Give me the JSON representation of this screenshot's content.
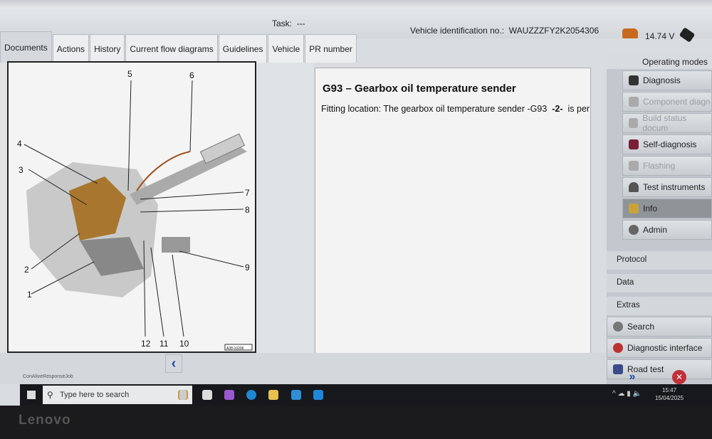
{
  "header": {
    "task_label": "Task:",
    "task_value": "---",
    "vin_label": "Vehicle identification no.:",
    "vin_value": "WAUZZZFY2K2054306",
    "voltage": "14.74 V"
  },
  "tabs": [
    {
      "label": "Documents",
      "active": true
    },
    {
      "label": "Actions"
    },
    {
      "label": "History"
    },
    {
      "label": "Current flow diagrams"
    },
    {
      "label": "Guidelines"
    },
    {
      "label": "Vehicle"
    },
    {
      "label": "PR number"
    }
  ],
  "diagram": {
    "callouts": [
      "1",
      "2",
      "3",
      "4",
      "5",
      "6",
      "7",
      "8",
      "9",
      "10",
      "11",
      "12"
    ],
    "ref_code": "A38-10206"
  },
  "content": {
    "title": "G93 – Gearbox oil temperature sender",
    "text_prefix": "Fitting location: The gearbox oil temperature sender -G93",
    "text_bold": "-2-",
    "text_suffix": "is permaner"
  },
  "sidebar": {
    "heading": "Operating modes",
    "modes": [
      {
        "label": "Diagnosis",
        "icon": "diagnosis-icon"
      },
      {
        "label": "Component diagn",
        "icon": "component-icon",
        "disabled": true
      },
      {
        "label": "Build status docum",
        "icon": "build-status-icon",
        "disabled": true
      },
      {
        "label": "Self-diagnosis",
        "icon": "self-diagnosis-icon"
      },
      {
        "label": "Flashing",
        "icon": "flashing-icon",
        "disabled": true
      },
      {
        "label": "Test instruments",
        "icon": "gauge-icon"
      },
      {
        "label": "Info",
        "icon": "info-icon",
        "selected": true
      },
      {
        "label": "Admin",
        "icon": "gear-icon"
      }
    ],
    "sections": [
      "Protocol",
      "Data",
      "Extras"
    ],
    "extras": [
      {
        "label": "Search",
        "icon": "magnifier-icon"
      },
      {
        "label": "Diagnostic interface",
        "icon": "interface-icon"
      },
      {
        "label": "Road test",
        "icon": "road-test-icon"
      }
    ]
  },
  "status": {
    "text": "ConAliveResponseJob"
  },
  "taskbar": {
    "search_placeholder": "Type here to search",
    "time": "15:47",
    "date": "15/04/2025"
  },
  "brand": "Lenovo"
}
